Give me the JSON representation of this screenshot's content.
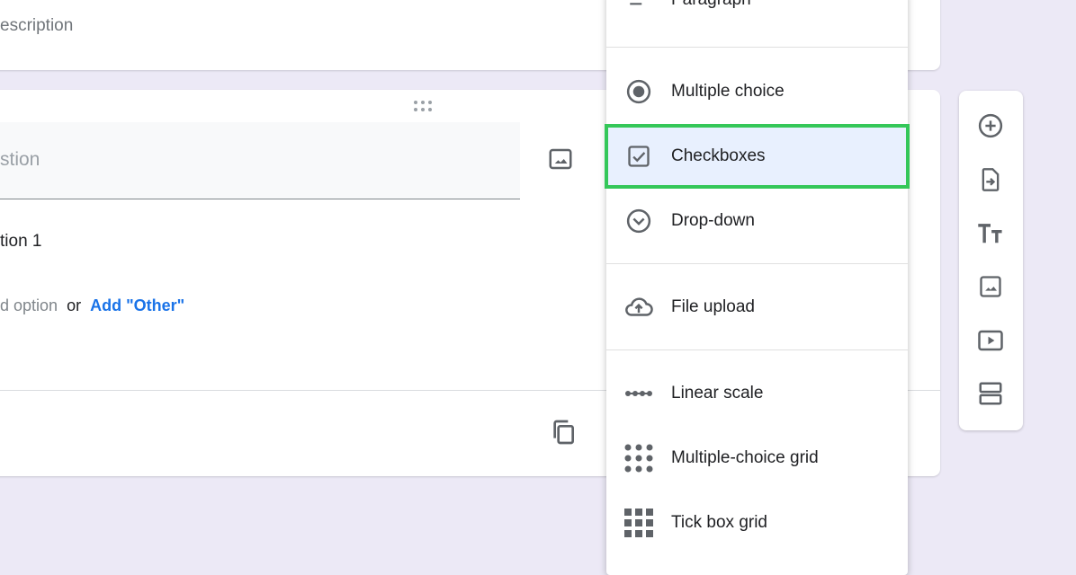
{
  "form": {
    "description_placeholder": "escription",
    "question_placeholder": "stion",
    "option_1": "tion 1",
    "add_option": "d option",
    "or": "or",
    "add_other": "Add \"Other\""
  },
  "type_menu": {
    "items": [
      {
        "label": "Paragraph",
        "icon": "paragraph-icon"
      },
      {
        "label": "Multiple choice",
        "icon": "radio-icon"
      },
      {
        "label": "Checkboxes",
        "icon": "checkbox-icon",
        "highlighted": true
      },
      {
        "label": "Drop-down",
        "icon": "dropdown-icon"
      },
      {
        "label": "File upload",
        "icon": "cloud-upload-icon"
      },
      {
        "label": "Linear scale",
        "icon": "linear-scale-icon"
      },
      {
        "label": "Multiple-choice grid",
        "icon": "grid-dots-icon"
      },
      {
        "label": "Tick box grid",
        "icon": "grid-squares-icon"
      }
    ]
  },
  "toolbar": {
    "items": [
      "add-question-icon",
      "import-questions-icon",
      "add-title-icon",
      "add-image-icon",
      "add-video-icon",
      "add-section-icon"
    ]
  },
  "colors": {
    "highlight_border": "#34c759",
    "link": "#1a73e8",
    "background": "#ece9f6"
  }
}
